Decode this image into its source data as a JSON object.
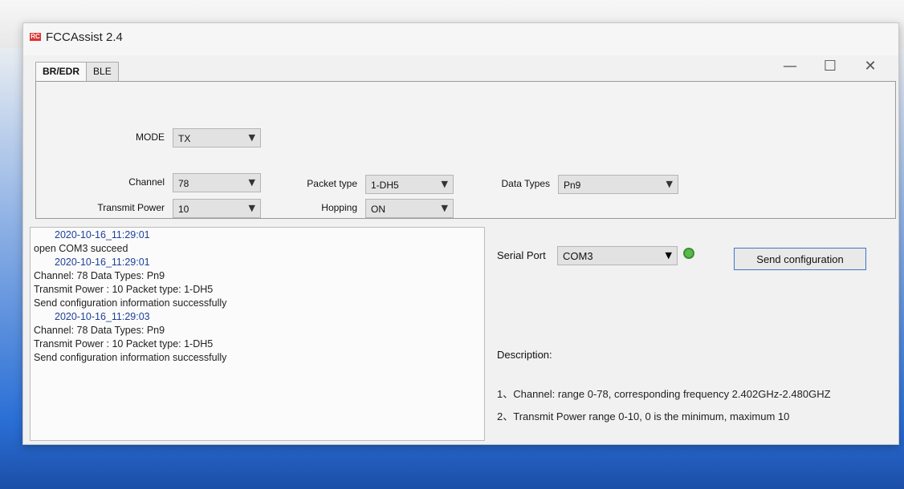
{
  "window": {
    "title": "FCCAssist 2.4",
    "controls": {
      "minimize": "—",
      "maximize": "☐",
      "close": "✕"
    }
  },
  "tabs": [
    {
      "label": "BR/EDR",
      "active": true
    },
    {
      "label": "BLE",
      "active": false
    }
  ],
  "config": {
    "mode": {
      "label": "MODE",
      "value": "TX"
    },
    "channel": {
      "label": "Channel",
      "value": "78"
    },
    "transmit_power": {
      "label": "Transmit Power",
      "value": "10"
    },
    "packet_type": {
      "label": "Packet type",
      "value": "1-DH5"
    },
    "hopping": {
      "label": "Hopping",
      "value": "ON"
    },
    "data_types": {
      "label": "Data Types",
      "value": "Pn9"
    }
  },
  "log": {
    "lines": [
      {
        "type": "ts",
        "text": "2020-10-16_11:29:01"
      },
      {
        "type": "msg",
        "text": "open COM3 succeed"
      },
      {
        "type": "ts",
        "text": "2020-10-16_11:29:01"
      },
      {
        "type": "msg",
        "text": "Channel: 78          Data Types: Pn9"
      },
      {
        "type": "msg",
        "text": "Transmit Power : 10      Packet type: 1-DH5"
      },
      {
        "type": "msg",
        "text": "Send configuration information successfully"
      },
      {
        "type": "ts",
        "text": "2020-10-16_11:29:03"
      },
      {
        "type": "msg",
        "text": "Channel: 78          Data Types: Pn9"
      },
      {
        "type": "msg",
        "text": "Transmit Power : 10      Packet type: 1-DH5"
      },
      {
        "type": "msg",
        "text": "Send configuration information successfully"
      }
    ]
  },
  "serial": {
    "label": "Serial Port",
    "value": "COM3",
    "status_color": "#59b94a",
    "send_label": "Send configuration"
  },
  "description": {
    "title": "Description:",
    "items": [
      "1、Channel: range 0-78, corresponding frequency 2.402GHz-2.480GHZ",
      "2、Transmit Power  range 0-10, 0 is the minimum, maximum 10"
    ]
  }
}
